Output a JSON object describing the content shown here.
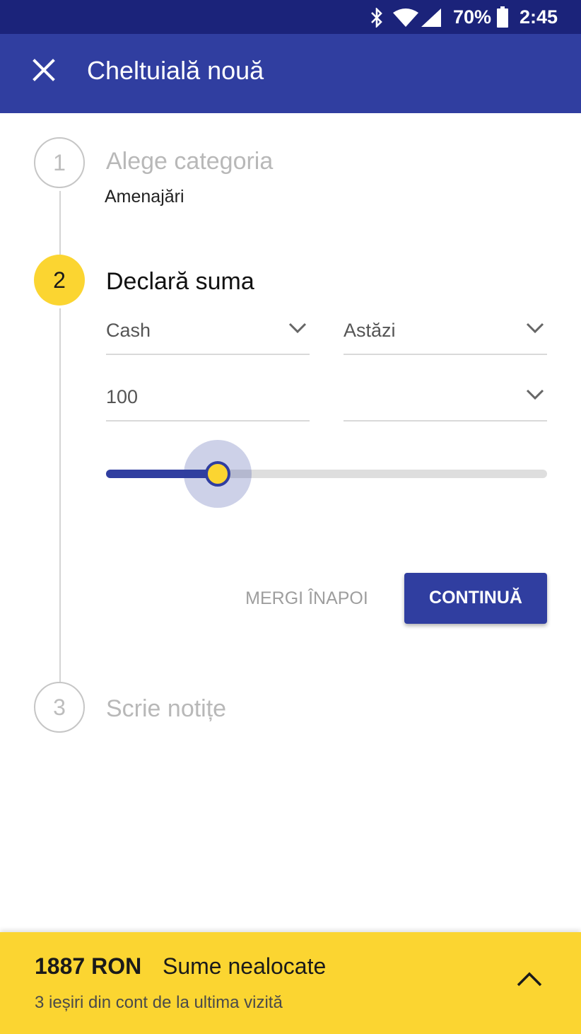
{
  "status_bar": {
    "icons": [
      "bluetooth-icon",
      "wifi-icon",
      "signal-icon",
      "battery-icon"
    ],
    "battery_percent": "70%",
    "time": "2:45"
  },
  "app_bar": {
    "close_icon": "close-icon",
    "title": "Cheltuială nouă"
  },
  "steps": [
    {
      "number": "1",
      "title": "Alege categoria",
      "subtitle": "Amenajări",
      "state": "completed"
    },
    {
      "number": "2",
      "title": "Declară suma",
      "state": "active"
    },
    {
      "number": "3",
      "title": "Scrie notițe",
      "state": "inactive"
    }
  ],
  "form": {
    "payment_method": "Cash",
    "date": "Astăzi",
    "amount": "100",
    "currency": "",
    "slider_level": 0.253
  },
  "actions": {
    "back_label": "MERGI ÎNAPOI",
    "continue_label": "CONTINUĂ"
  },
  "bottom_sheet": {
    "amount": "1887 RON",
    "label": "Sume nealocate",
    "subtitle": "3 ieșiri din cont de la ultima vizită",
    "expand_icon": "chevron-up-icon"
  },
  "colors": {
    "primary": "#303ea0",
    "status_bar": "#1b237a",
    "accent": "#fbd531"
  }
}
